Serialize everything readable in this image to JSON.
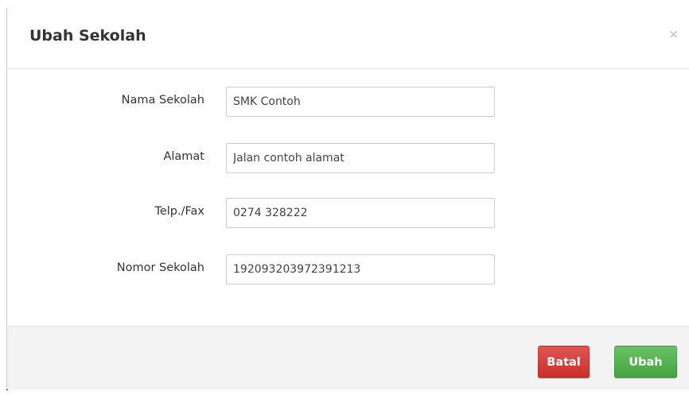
{
  "modal": {
    "title": "Ubah Sekolah",
    "close_label": "×"
  },
  "form": {
    "fields": [
      {
        "label": "Nama Sekolah",
        "value": "SMK Contoh"
      },
      {
        "label": "Alamat",
        "value": "Jalan contoh alamat"
      },
      {
        "label": "Telp./Fax",
        "value": "0274 328222"
      },
      {
        "label": "Nomor Sekolah",
        "value": "192093203972391213"
      }
    ]
  },
  "footer": {
    "cancel_label": "Batal",
    "submit_label": "Ubah"
  },
  "colors": {
    "cancel_button": "#d9534f",
    "submit_button": "#5cb85c",
    "footer_background": "#f3f3f3"
  }
}
